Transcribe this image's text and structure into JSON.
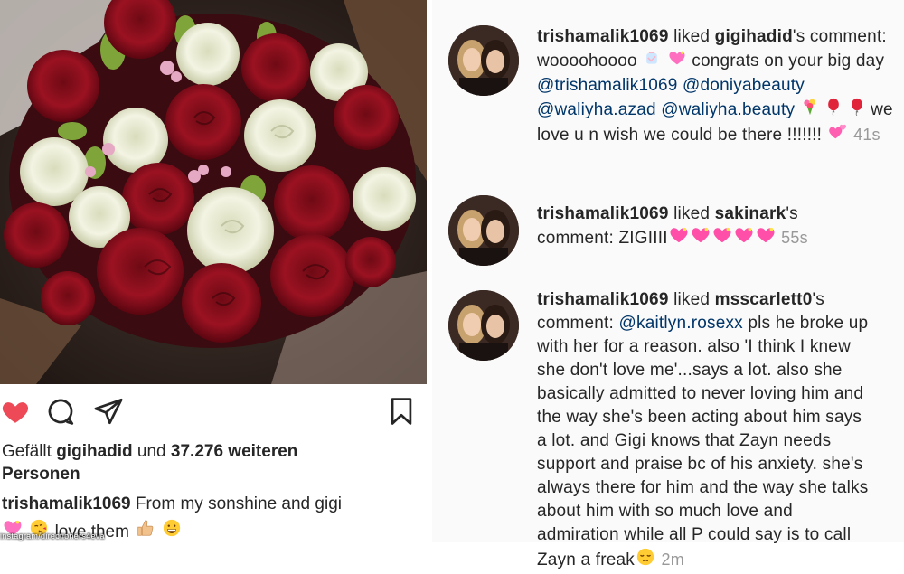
{
  "post": {
    "likes_prefix": "Gefällt",
    "liker": "gigihadid",
    "likes_mid": "und",
    "likes_count": "37.276 weiteren",
    "likes_suffix": "Personen",
    "caption_user": "trishamalik1069",
    "caption_text": "From my sonshine and gigi",
    "caption_text2": "love them",
    "watermark": "instagram/directioners4eva"
  },
  "icons": [
    "heart-filled-icon",
    "comment-icon",
    "share-icon",
    "bookmark-icon"
  ],
  "colors": {
    "heart": "#ed4956",
    "mention": "#003569",
    "time": "#999999",
    "panel_bg": "#fafafa"
  },
  "notifications": [
    {
      "user": "trishamalik1069",
      "liked": "liked",
      "target": "gigihadid",
      "possessive": "'s",
      "comment_label": "comment:",
      "text_a": "woooohoooo",
      "text_b": "congrats on your big day",
      "mentions": [
        "@trishamalik1069",
        "@doniyabeauty",
        "@waliyha.azad",
        "@waliyha.beauty"
      ],
      "text_c": "we love u n wish we could be there !!!!!!!",
      "time": "41s"
    },
    {
      "user": "trishamalik1069",
      "liked": "liked",
      "target": "sakinark",
      "possessive": "'s",
      "comment_label": "comment:",
      "text_a": "ZIGIIII",
      "time": "55s"
    },
    {
      "user": "trishamalik1069",
      "liked": "liked",
      "target": "msscarlett0",
      "possessive": "'s",
      "comment_label": "comment:",
      "mention": "@kaitlyn.rosexx",
      "text_a": "pls he broke up",
      "line3": "with her for a reason. also 'I think I knew",
      "line4": "she don't love me'...says a lot. also she",
      "line5": "basically admitted to never loving him and",
      "line6": "the way she's been acting about him says",
      "line7": "a lot. and Gigi knows that Zayn needs",
      "line8": "support and praise bc of his anxiety. she's",
      "line9": "always there for him and the way she talks",
      "line10": "about him with so much love and",
      "line11": "admiration while all P could say is to call",
      "line12": "Zayn a freak",
      "time": "2m"
    }
  ]
}
